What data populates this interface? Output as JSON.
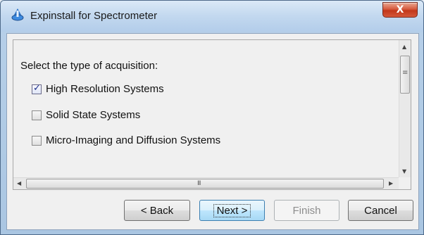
{
  "window": {
    "title": "Expinstall for Spectrometer",
    "close_label": "X"
  },
  "panel": {
    "prompt": "Select the type of acquisition:",
    "options": [
      {
        "label": "High Resolution Systems",
        "checked": true
      },
      {
        "label": "Solid State Systems",
        "checked": false
      },
      {
        "label": "Micro-Imaging and Diffusion Systems",
        "checked": false
      }
    ]
  },
  "scrollbars": {
    "vertical_grip": "≡",
    "horizontal_grip": "III"
  },
  "buttons": {
    "back": "< Back",
    "next": "Next >",
    "finish": "Finish",
    "cancel": "Cancel"
  },
  "colors": {
    "title_gradient_top": "#dbe9f7",
    "close_red": "#c2371a",
    "default_button_border": "#3c7fb1"
  },
  "icons": [
    "app-spectrometer-icon",
    "close-icon",
    "checkbox-checked-icon",
    "checkbox-unchecked-icon",
    "scroll-up-arrow-icon",
    "scroll-down-arrow-icon",
    "scroll-left-arrow-icon",
    "scroll-right-arrow-icon"
  ]
}
